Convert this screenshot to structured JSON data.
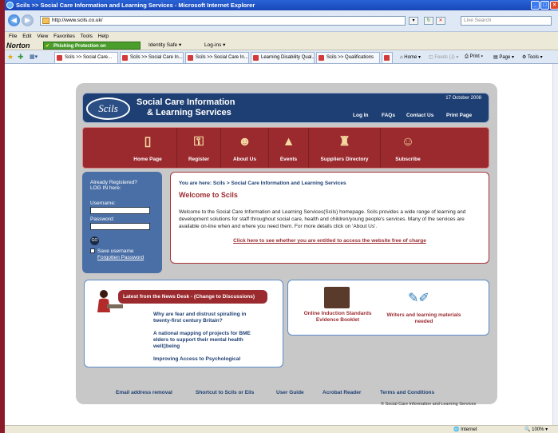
{
  "browser": {
    "title": "Scils >> Social Care Information and Learning Services - Microsoft Internet Explorer",
    "address": "http://www.scils.co.uk/",
    "search_placeholder": "Live Search",
    "menu": [
      "File",
      "Edit",
      "View",
      "Favorites",
      "Tools",
      "Help"
    ],
    "norton": {
      "logo": "Norton",
      "phishing": "Phishing Protection on",
      "identity": "Identity Safe ▾",
      "logins": "Log-ins ▾"
    },
    "tabs": [
      {
        "label": "Scils >> Social Care..."
      },
      {
        "label": "Scils >> Social Care In..."
      },
      {
        "label": "Scils >> Social Care In..."
      },
      {
        "label": "Learning Disability Qual..."
      },
      {
        "label": "Scils >> Qualifications"
      }
    ],
    "commands": [
      "Home",
      "Feeds (J)",
      "Print",
      "Page",
      "Tools"
    ],
    "status": {
      "zone": "Internet",
      "zoom": "100%"
    }
  },
  "site": {
    "logo": "Scils",
    "brand_line1": "Social Care Information",
    "brand_line2": "& Learning Services",
    "date": "17 October 2008",
    "top_links": [
      "Log In",
      "FAQs",
      "Contact Us",
      "Print Page"
    ],
    "nav": [
      {
        "label": "Home Page",
        "icon": "door-icon"
      },
      {
        "label": "Register",
        "icon": "key-icon"
      },
      {
        "label": "About Us",
        "icon": "group-icon"
      },
      {
        "label": "Events",
        "icon": "easel-icon"
      },
      {
        "label": "Suppliers Directory",
        "icon": "desk-icon"
      },
      {
        "label": "Subscribe",
        "icon": "people-icon"
      }
    ],
    "login": {
      "intro1": "Already Registered?",
      "intro2": "LOG IN here:",
      "username_label": "Username:",
      "password_label": "Password:",
      "go": "GO",
      "remember": "Save username",
      "forgot": "Forgotten Password"
    },
    "welcome": {
      "breadcrumb": "You are here: Scils > Social Care Information and Learning Services",
      "title": "Welcome to Scils",
      "body": "Welcome to the Social Care Information and Learning Services(Scils) homepage. Scils provides a wide range of learning and development solutions for staff throughout social care, health and children/young people's services. Many of the services are available on-line when and where you need them. For more details click on 'About Us'.",
      "link": "Click here to see whether you are entitled to access the website free of charge"
    },
    "news": {
      "header": "Latest from the News Desk - (Change to Discussions)",
      "items": [
        "Why are fear and distrust spiralling in twenty-first century Britain?",
        "A national mapping of projects for BME elders to support their mental health well▯being",
        "Improving Access to Psychological"
      ]
    },
    "promos": [
      {
        "label": "Online Induction Standards Evidence Booklet"
      },
      {
        "label": "Writers and learning materials needed"
      }
    ],
    "footer_links": [
      "Email address removal",
      "Shortcut to Scils or Eils",
      "User Guide",
      "Acrobat Reader",
      "Terms and Conditions"
    ],
    "copyright": "© Social Care Information and Learning Services"
  }
}
